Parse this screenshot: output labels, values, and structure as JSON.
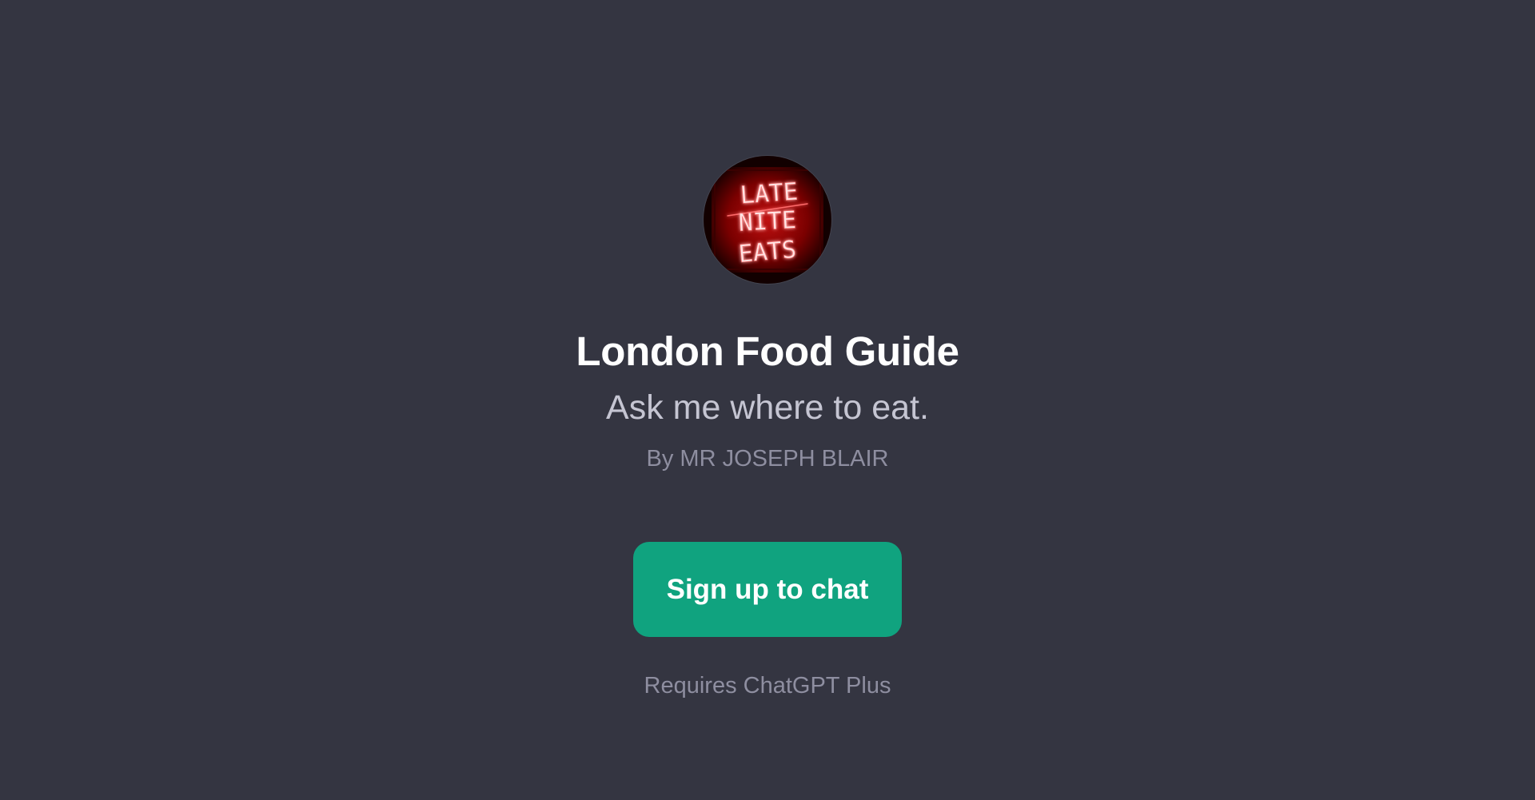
{
  "gpt": {
    "avatar": {
      "icon": "neon-sign-icon",
      "sign_lines": [
        "LATE",
        "NITE",
        "EATS"
      ],
      "neon_color": "#ff4a4a",
      "glow_color": "#b30000"
    },
    "title": "London Food Guide",
    "description": "Ask me where to eat.",
    "author": "By MR JOSEPH BLAIR"
  },
  "cta": {
    "label": "Sign up to chat",
    "color": "#10a37f"
  },
  "requirement_note": "Requires ChatGPT Plus",
  "colors": {
    "background": "#343541",
    "title": "#ffffff",
    "subtitle": "#c5c5d2",
    "muted": "#8e8ea0"
  }
}
